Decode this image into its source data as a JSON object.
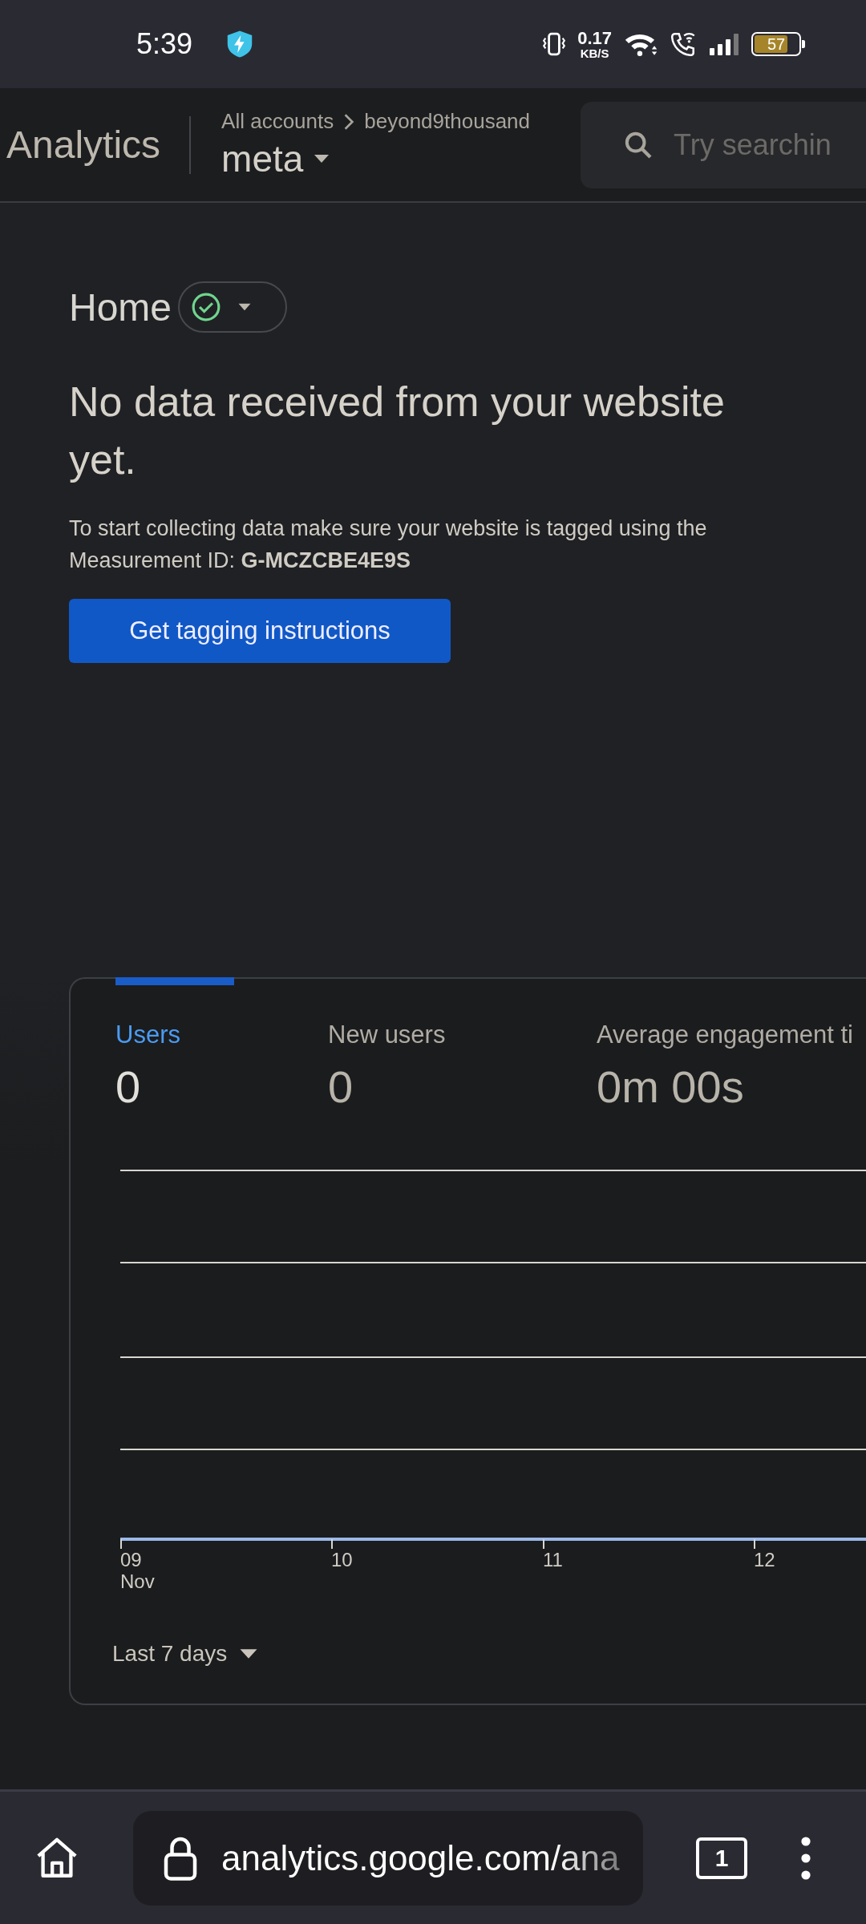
{
  "status_bar": {
    "time": "5:39",
    "speed_value": "0.17",
    "speed_unit": "KB/S",
    "battery": "57"
  },
  "header": {
    "product": "Analytics",
    "breadcrumb": [
      "All accounts",
      "beyond9thousand"
    ],
    "property": "meta",
    "search": {
      "placeholder": "Try searchin"
    }
  },
  "page": {
    "title": "Home",
    "heading": "No data received from your website yet.",
    "body": "To start collecting data make sure your website is tagged using the Measurement ID: **G-MCZCBE4E9S**",
    "button": "Get tagging instructions"
  },
  "card": {
    "metrics": [
      {
        "label": "Users",
        "value": "0",
        "selected": true
      },
      {
        "label": "New users",
        "value": "0",
        "selected": false
      },
      {
        "label": "Average engagement ti",
        "value": "0m 00s",
        "selected": false
      }
    ],
    "x_labels": [
      [
        "09",
        "Nov"
      ],
      [
        "10"
      ],
      [
        "11"
      ],
      [
        "12"
      ]
    ],
    "range": "Last 7 days"
  },
  "browser": {
    "url": "analytics.google.com/ana",
    "tabs": "1"
  }
}
